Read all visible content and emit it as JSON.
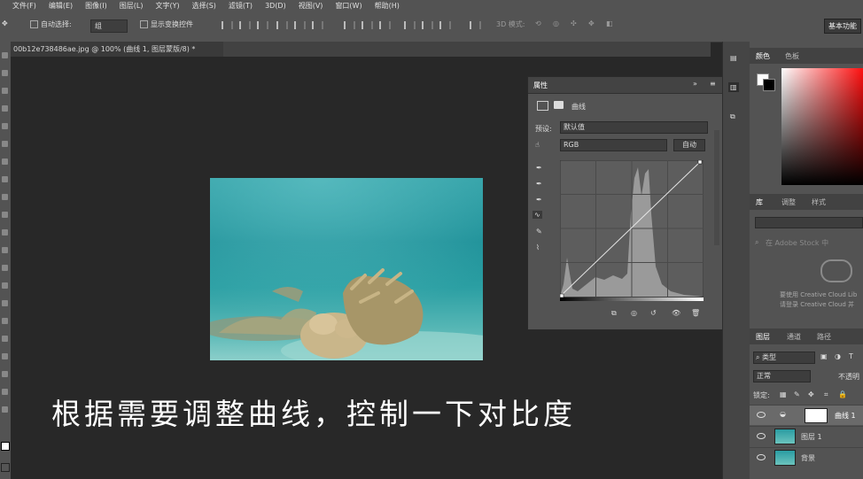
{
  "menu": [
    "文件(F)",
    "编辑(E)",
    "图像(I)",
    "图层(L)",
    "文字(Y)",
    "选择(S)",
    "滤镜(T)",
    "3D(D)",
    "视图(V)",
    "窗口(W)",
    "帮助(H)"
  ],
  "options": {
    "auto_select_label": "自动选择:",
    "auto_select_value": "组",
    "show_transform_label": "显示变换控件",
    "mode_3d_label": "3D 模式:",
    "workspace_label": "基本功能"
  },
  "document": {
    "tab_title": "00b12e738486ae.jpg @ 100% (曲线 1, 图层蒙版/8) *"
  },
  "subtitle": "根据需要调整曲线，控制一下对比度",
  "properties": {
    "panel_title": "属性",
    "adjustment_name": "曲线",
    "preset_label": "预设:",
    "preset_value": "默认值",
    "channel_value": "RGB",
    "auto_button": "自动"
  },
  "right_panels": {
    "color_tabs": [
      "颜色",
      "色板"
    ],
    "library_tabs": [
      "库",
      "调整",
      "样式"
    ],
    "library_search_placeholder": "在 Adobe Stock 中",
    "library_msg_1": "要使用 Creative Cloud Lib",
    "library_msg_2": "请登录 Creative Cloud 并",
    "layers_tabs": [
      "图层",
      "通道",
      "路径"
    ],
    "filter_kind": "类型",
    "blend_mode": "正常",
    "opacity_label": "不透明",
    "lock_label": "锁定:",
    "layers": [
      {
        "name": "曲线 1"
      },
      {
        "name": "图层 1"
      },
      {
        "name": "背景"
      }
    ]
  },
  "colors": {
    "panel_bg": "#535353",
    "canvas_bg": "#282828",
    "water": "#1c8f97"
  }
}
